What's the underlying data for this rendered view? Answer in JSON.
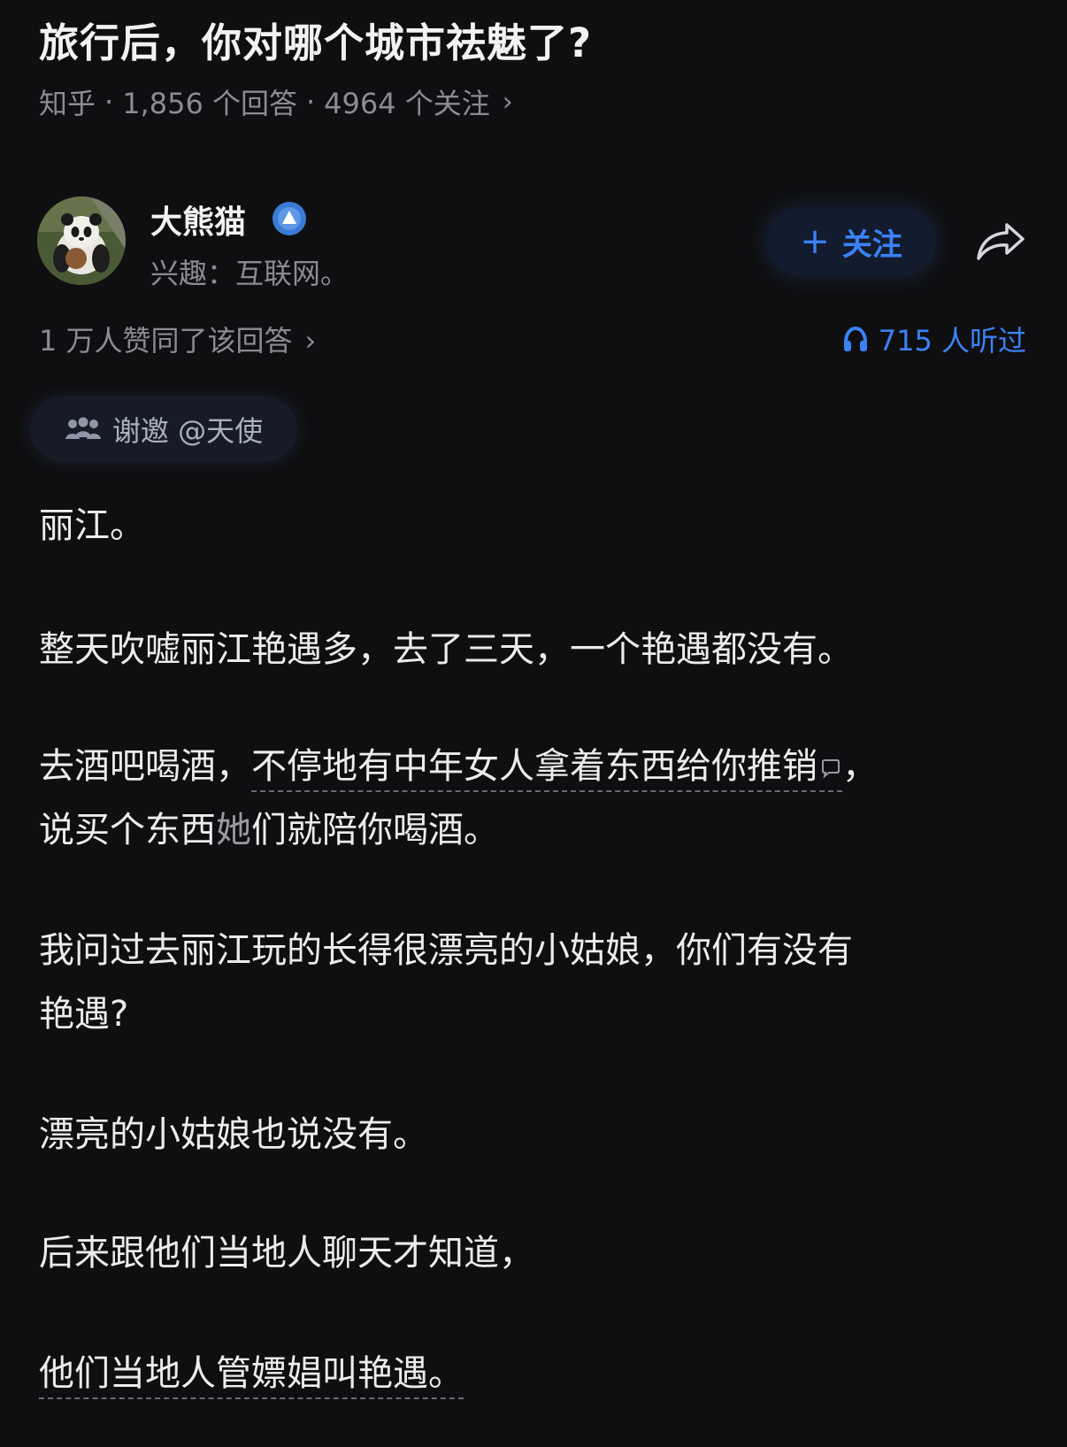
{
  "question": {
    "title": "旅行后，你对哪个城市祛魅了?",
    "platform": "知乎",
    "answers_count": "1,856 个回答",
    "followers_count": "4964 个关注",
    "separator": "·",
    "chevron": "›"
  },
  "author": {
    "name": "大熊猫",
    "bio": "兴趣：互联网。",
    "avatar_icon": "panda-avatar",
    "badge_icon": "verified-badge-icon"
  },
  "actions": {
    "follow_plus": "+",
    "follow_label": "关注",
    "share_icon": "share-arrow-icon"
  },
  "stats": {
    "upvotes": "1 万人赞同了该回答",
    "listeners": "715 人听过",
    "chevron": "›"
  },
  "invite": {
    "label": "谢邀 @天使"
  },
  "answer": {
    "p1": "丽江。",
    "p2": "整天吹嘘丽江艳遇多，去了三天，一个艳遇都没有。",
    "p3_lead": "去酒吧喝酒，",
    "p3_link": "不停地有中年女人拿着东西给你推销",
    "p3_end": "，",
    "p3b_a": "说买个东西",
    "p3b_obscured": "她",
    "p3b_b": "们就陪你喝酒。",
    "p4a": "我问过去丽江玩的长得很漂亮的小姑娘，你们有没有",
    "p4b": "艳遇?",
    "p5": "漂亮的小姑娘也说没有。",
    "p6": "后来跟他们当地人聊天才知道，",
    "p7": "他们当地人管嫖娼叫艳遇。"
  },
  "colors": {
    "background": "#0f0f11",
    "accent_blue": "#3b82f6",
    "muted_text": "#8a8c93",
    "body_text": "#ececee"
  }
}
